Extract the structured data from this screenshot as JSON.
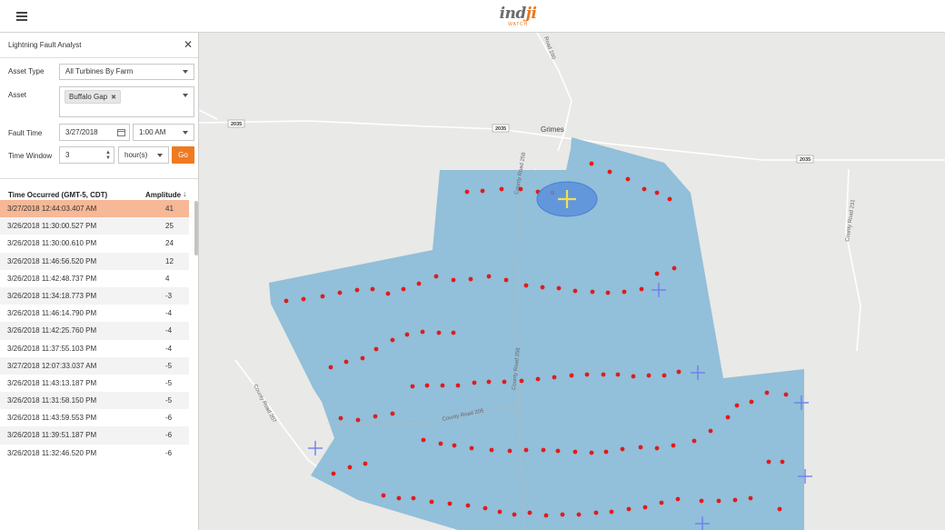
{
  "header": {
    "menu_icon": "hamburger-menu-icon",
    "logo_main": "ind",
    "logo_accent": "ji",
    "logo_sub": "WATCH"
  },
  "panel": {
    "title": "Lightning Fault Analyst",
    "close_icon": "close-icon",
    "asset_type_label": "Asset Type",
    "asset_type_value": "All Turbines By Farm",
    "asset_label": "Asset",
    "asset_tag": "Buffalo Gap",
    "fault_time_label": "Fault Time",
    "fault_date": "3/27/2018",
    "fault_hour": "1:00 AM",
    "time_window_label": "Time Window",
    "time_window_value": "3",
    "time_window_unit": "hour(s)",
    "go_label": "Go"
  },
  "table": {
    "col_time": "Time Occurred (GMT-5, CDT)",
    "col_amp": "Amplitude",
    "sort_icon": "sort-desc-arrow-icon",
    "rows": [
      {
        "time": "3/27/2018 12:44:03.407 AM",
        "amp": "41"
      },
      {
        "time": "3/26/2018 11:30:00.527 PM",
        "amp": "25"
      },
      {
        "time": "3/26/2018 11:30:00.610 PM",
        "amp": "24"
      },
      {
        "time": "3/26/2018 11:46:56.520 PM",
        "amp": "12"
      },
      {
        "time": "3/26/2018 11:42:48.737 PM",
        "amp": "4"
      },
      {
        "time": "3/26/2018 11:34:18.773 PM",
        "amp": "-3"
      },
      {
        "time": "3/26/2018 11:46:14.790 PM",
        "amp": "-4"
      },
      {
        "time": "3/26/2018 11:42:25.760 PM",
        "amp": "-4"
      },
      {
        "time": "3/26/2018 11:37:55.103 PM",
        "amp": "-4"
      },
      {
        "time": "3/27/2018 12:07:33.037 AM",
        "amp": "-5"
      },
      {
        "time": "3/26/2018 11:43:13.187 PM",
        "amp": "-5"
      },
      {
        "time": "3/26/2018 11:31:58.150 PM",
        "amp": "-5"
      },
      {
        "time": "3/26/2018 11:43:59.553 PM",
        "amp": "-6"
      },
      {
        "time": "3/26/2018 11:39:51.187 PM",
        "amp": "-6"
      },
      {
        "time": "3/26/2018 11:32:46.520 PM",
        "amp": "-6"
      }
    ]
  },
  "map": {
    "place": "Grimes",
    "shields": [
      "2035",
      "2035",
      "2035"
    ],
    "road_labels": [
      "Road 190",
      "County Road 258",
      "County Road 231",
      "County Road 258",
      "County Road 205",
      "County Road 207"
    ],
    "colors": {
      "farm_area": "#8dbdd8",
      "turbine": "#e21b1b",
      "strike": "#6f7ef0",
      "selected_strike": "#f4e04a",
      "ellipse": "#5b8fdc"
    }
  }
}
